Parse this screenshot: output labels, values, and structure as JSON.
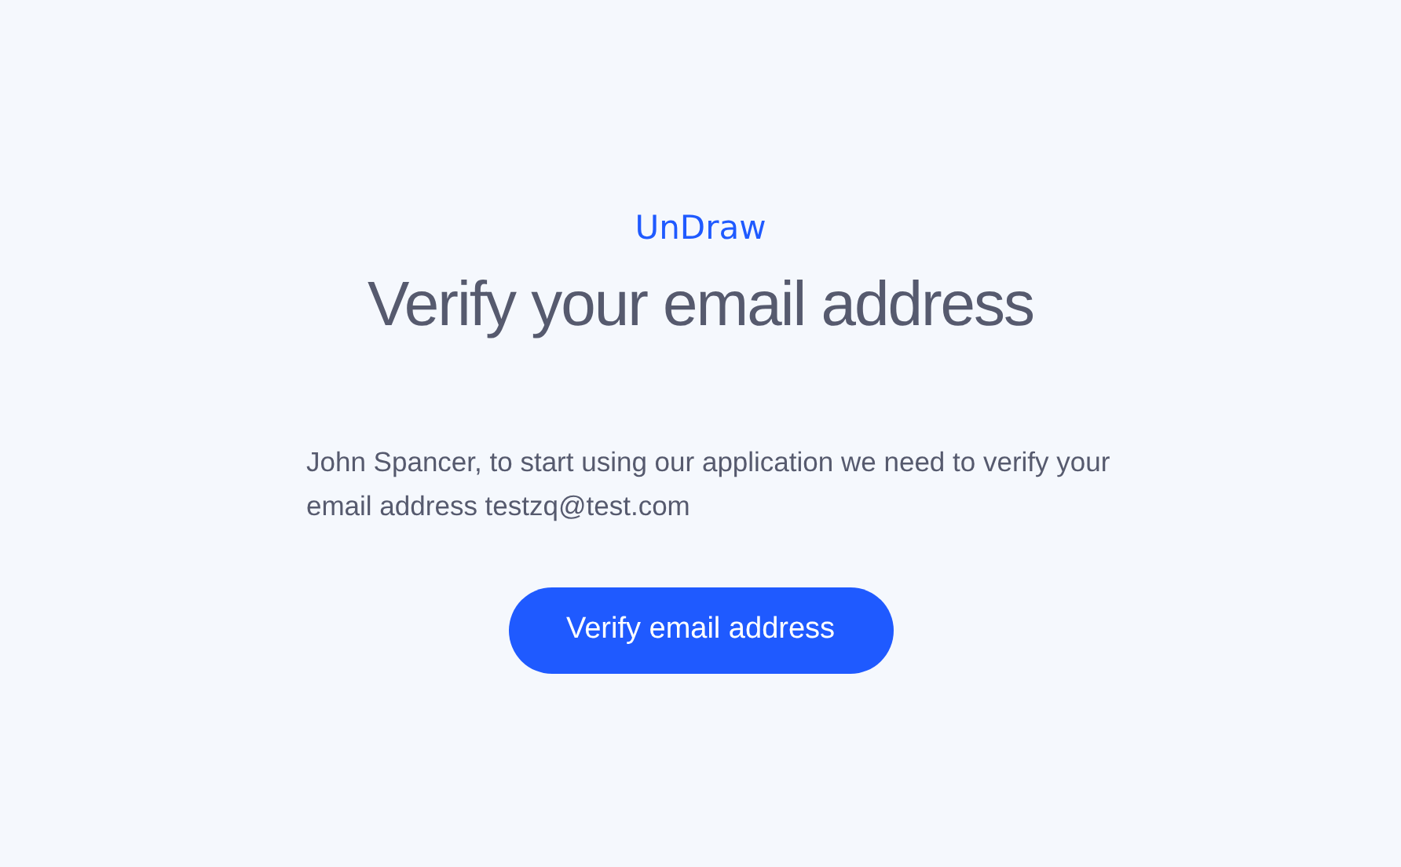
{
  "brand": "UnDraw",
  "title": "Verify your email address",
  "message": "John Spancer, to start using our application we need to verify your email address testzq@test.com",
  "button": "Verify email address"
}
